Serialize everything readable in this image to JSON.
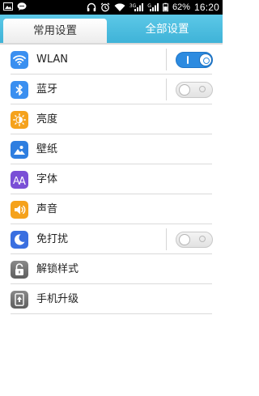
{
  "status_bar": {
    "battery": "62%",
    "time": "16:20",
    "signal_label_1": "3G",
    "signal_label_2": "G"
  },
  "tabs": [
    {
      "label": "常用设置",
      "active": true
    },
    {
      "label": "全部设置",
      "active": false
    }
  ],
  "rows": [
    {
      "label": "WLAN",
      "icon": "wifi-icon",
      "icon_color": "#3a8ff0",
      "toggle": "on"
    },
    {
      "label": "蓝牙",
      "icon": "bluetooth-icon",
      "icon_color": "#3a8ff0",
      "toggle": "off"
    },
    {
      "label": "亮度",
      "icon": "brightness-icon",
      "icon_color": "#f5a21c",
      "toggle": null
    },
    {
      "label": "壁纸",
      "icon": "wallpaper-icon",
      "icon_color": "#2e7ee0",
      "toggle": null
    },
    {
      "label": "字体",
      "icon": "font-icon",
      "icon_color": "#7a4fd6",
      "toggle": null
    },
    {
      "label": "声音",
      "icon": "sound-icon",
      "icon_color": "#f5a21c",
      "toggle": null
    },
    {
      "label": "免打扰",
      "icon": "do-not-disturb-icon",
      "icon_color": "#3a6fe0",
      "toggle": "off"
    },
    {
      "label": "解锁样式",
      "icon": "unlock-style-icon",
      "icon_color": "#777777",
      "toggle": null
    },
    {
      "label": "手机升级",
      "icon": "phone-upgrade-icon",
      "icon_color": "#777777",
      "toggle": null
    }
  ]
}
